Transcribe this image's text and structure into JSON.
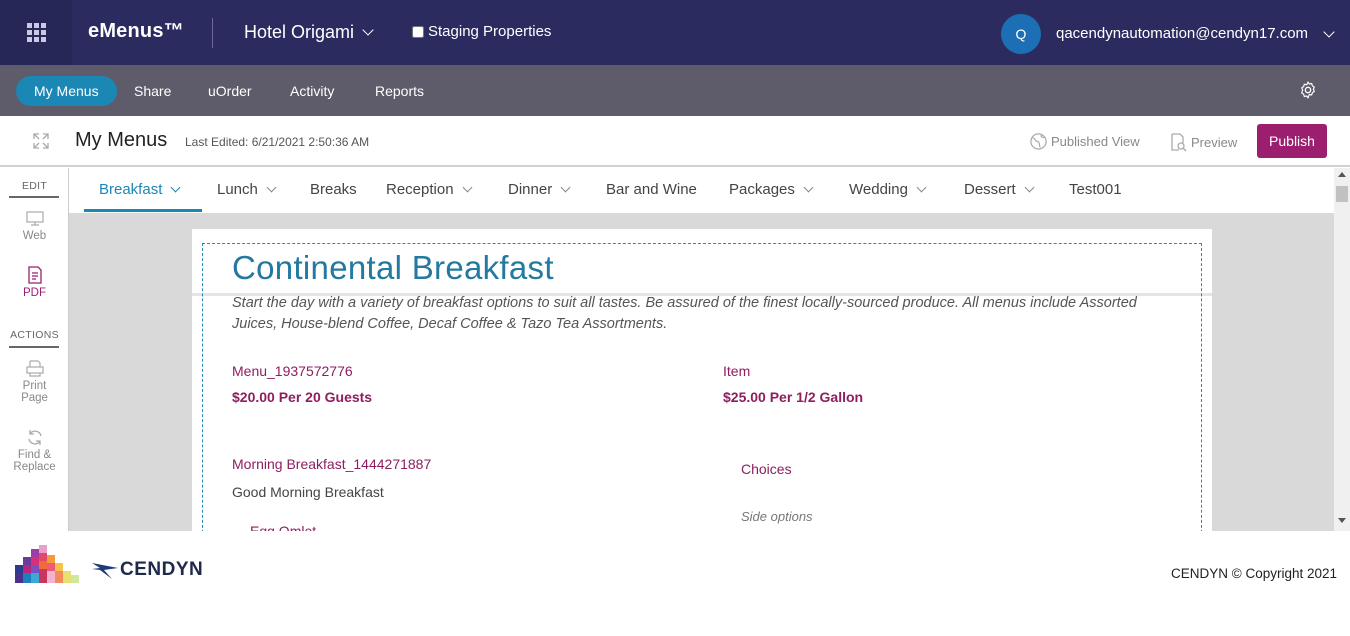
{
  "topbar": {
    "brand": "eMenus™",
    "property": "Hotel Origami",
    "staging_label": "Staging Properties",
    "staging_checked": false,
    "avatar_initial": "Q",
    "user_email": "qacendynautomation@cendyn17.com"
  },
  "nav": {
    "items": [
      {
        "label": "My Menus",
        "active": true
      },
      {
        "label": "Share"
      },
      {
        "label": "uOrder"
      },
      {
        "label": "Activity"
      },
      {
        "label": "Reports"
      }
    ]
  },
  "page_header": {
    "title": "My Menus",
    "last_edited": "Last Edited: 6/21/2021 2:50:36 AM",
    "published_view": "Published View",
    "preview": "Preview",
    "publish": "Publish"
  },
  "side_tools": {
    "edit_label": "EDIT",
    "web": "Web",
    "pdf": "PDF",
    "actions_label": "ACTIONS",
    "print_1": "Print",
    "print_2": "Page",
    "find_1": "Find &",
    "find_2": "Replace"
  },
  "menu_tabs": [
    {
      "label": "Breakfast",
      "dropdown": true,
      "active": true
    },
    {
      "label": "Lunch",
      "dropdown": true
    },
    {
      "label": "Breaks",
      "dropdown": false
    },
    {
      "label": "Reception",
      "dropdown": true
    },
    {
      "label": "Dinner",
      "dropdown": true
    },
    {
      "label": "Bar and Wine",
      "dropdown": false
    },
    {
      "label": "Packages",
      "dropdown": true
    },
    {
      "label": "Wedding",
      "dropdown": true
    },
    {
      "label": "Dessert",
      "dropdown": true
    },
    {
      "label": "Test001",
      "dropdown": false
    }
  ],
  "menu_content": {
    "title": "Continental Breakfast",
    "description": "Start the day with a variety of breakfast options to suit all tastes. Be assured of the finest locally-sourced produce. All menus include Assorted Juices, House-blend Coffee, Decaf Coffee & Tazo Tea Assortments.",
    "item1_name": "Menu_1937572776",
    "item1_price": "$20.00 Per 20 Guests",
    "item2_name": "Item",
    "item2_price": "$25.00 Per 1/2 Gallon",
    "item3_name": "Morning Breakfast_1444271887",
    "item3_sub": "Good Morning Breakfast",
    "item3_child": "Egg Omlet",
    "choices": "Choices",
    "side_options": "Side options"
  },
  "footer": {
    "logo_text": "CENDYN",
    "copyright": "CENDYN © Copyright 2021"
  },
  "colors": {
    "topbar": "#2b2b60",
    "navbar": "#5e5c6a",
    "accent_blue": "#1b87b5",
    "publish": "#9b1f6e",
    "item_text": "#8e1e60"
  }
}
